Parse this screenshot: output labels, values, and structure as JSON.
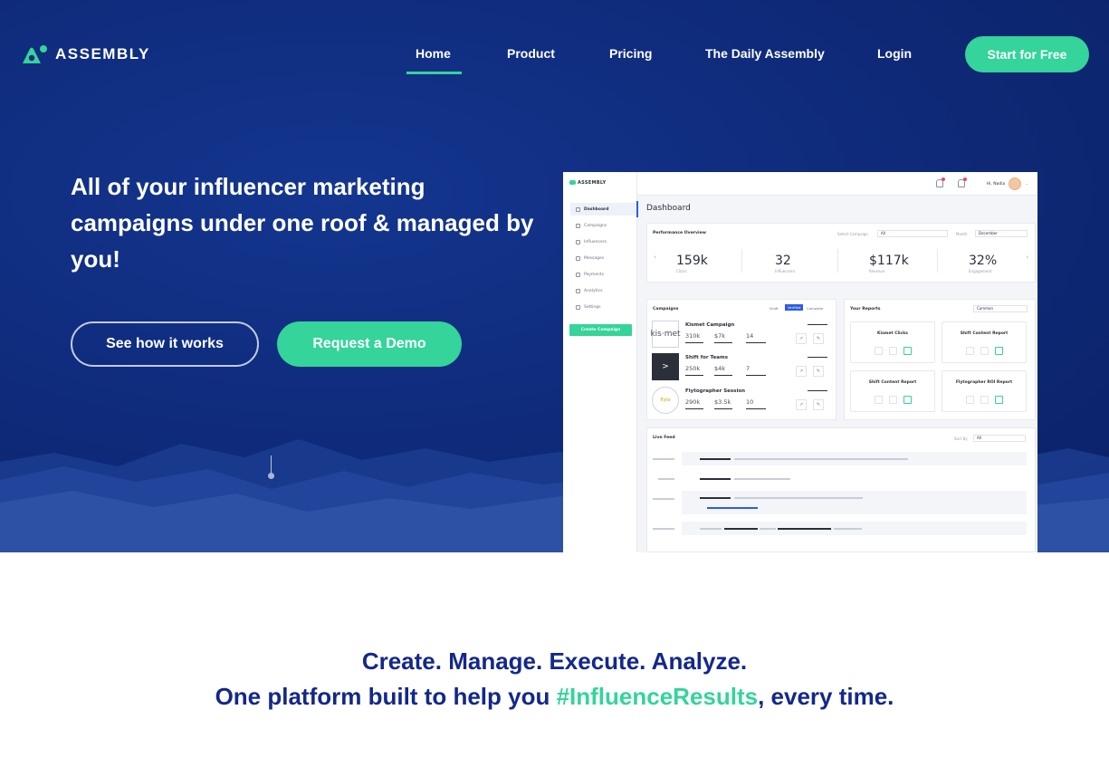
{
  "brand": {
    "logo_text": "ASSEMBLY"
  },
  "nav": {
    "items": [
      "Home",
      "Product",
      "Pricing",
      "The Daily Assembly",
      "Login"
    ],
    "active": "Home",
    "cta": "Start for Free"
  },
  "hero": {
    "headline": "All of your influencer marketing campaigns under one roof & managed by you!",
    "secondary_button": "See how it works",
    "primary_button": "Request a Demo"
  },
  "dashboard": {
    "brand": "ASSEMBLY",
    "sidebar": [
      "Dashboard",
      "Campaigns",
      "Influencers",
      "Messages",
      "Payments",
      "Analytics",
      "Settings"
    ],
    "create_button": "Create Campaign",
    "user": "Hi, Nadia",
    "title": "Dashboard",
    "performance": {
      "title": "Performance Overview",
      "select_campaign_label": "Select Campaign",
      "select_campaign_value": "All",
      "month_label": "Month",
      "month_value": "December",
      "metrics": [
        {
          "value": "159k",
          "label": "Clicks"
        },
        {
          "value": "32",
          "label": "Influencers"
        },
        {
          "value": "$117k",
          "label": "Revenue"
        },
        {
          "value": "32%",
          "label": "Engagement"
        }
      ]
    },
    "campaigns": {
      "title": "Campaigns",
      "tabs": [
        "Draft",
        "Verified",
        "Complete"
      ],
      "rows": [
        {
          "name": "Kismet Campaign",
          "logo": "kis·met",
          "clicks": "310k",
          "revenue": "$7k",
          "influencers": "14"
        },
        {
          "name": "Shift for Teams",
          "logo": ">",
          "clicks": "250k",
          "revenue": "$4k",
          "influencers": "7"
        },
        {
          "name": "Flytographer Session",
          "logo": "flyto",
          "clicks": "290k",
          "revenue": "$3.5k",
          "influencers": "10"
        }
      ]
    },
    "reports": {
      "title": "Your Reports",
      "filter": "Common",
      "items": [
        "Kismet Clicks",
        "Shift Content Report",
        "Shift Content Report",
        "Flytographer ROI Report"
      ]
    },
    "live_feed": {
      "title": "Live Feed",
      "sort_label": "Sort By",
      "sort_value": "All"
    }
  },
  "tagline": {
    "line1": "Create. Manage. Execute. Analyze.",
    "line2_before": "One platform built to help you ",
    "line2_hashtag": "#InfluenceResults",
    "line2_after": ", every time."
  },
  "colors": {
    "accent": "#34d49a",
    "hero_bg": "#0f2b7c",
    "tagline": "#13288a"
  },
  "icons": {
    "logo": "assembly-logo-icon",
    "scroll": "scroll-indicator-icon"
  }
}
